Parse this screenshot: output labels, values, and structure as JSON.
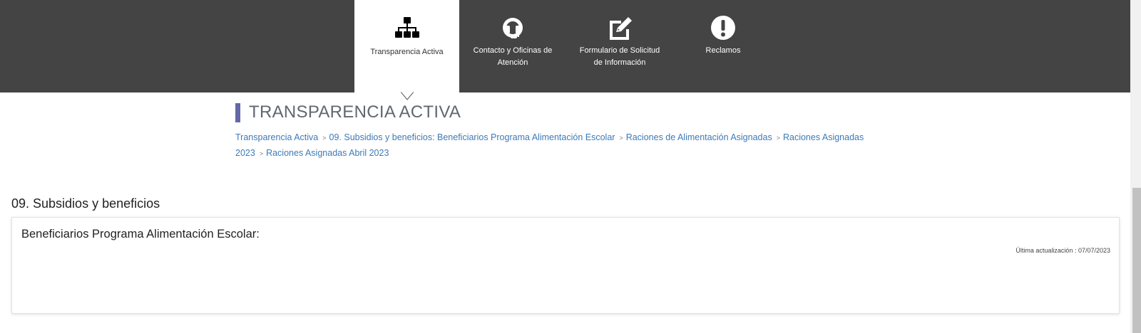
{
  "nav": {
    "tabs": [
      {
        "label": "Transparencia Activa",
        "icon": "sitemap-icon",
        "active": true
      },
      {
        "label": "Contacto y Oficinas de Atención",
        "icon": "headset-icon",
        "active": false
      },
      {
        "label": "Formulario de Solicitud de Información",
        "icon": "edit-icon",
        "active": false
      },
      {
        "label": "Reclamos",
        "icon": "exclamation-icon",
        "active": false
      }
    ]
  },
  "heading": {
    "title": "TRANSPARENCIA ACTIVA"
  },
  "breadcrumb": {
    "items": [
      "Transparencia Activa",
      "09. Subsidios y beneficios: Beneficiarios Programa Alimentación Escolar",
      "Raciones de Alimentación Asignadas",
      "Raciones Asignadas 2023",
      "Raciones Asignadas Abril 2023"
    ],
    "separator": ">"
  },
  "section": {
    "title": "09. Subsidios y beneficios",
    "card_title": "Beneficiarios Programa Alimentación Escolar:",
    "updated": "Última actualización : 07/07/2023"
  },
  "colors": {
    "nav_bg": "#444444",
    "accent_bar": "#6468a8",
    "link": "#3d7ab8"
  }
}
